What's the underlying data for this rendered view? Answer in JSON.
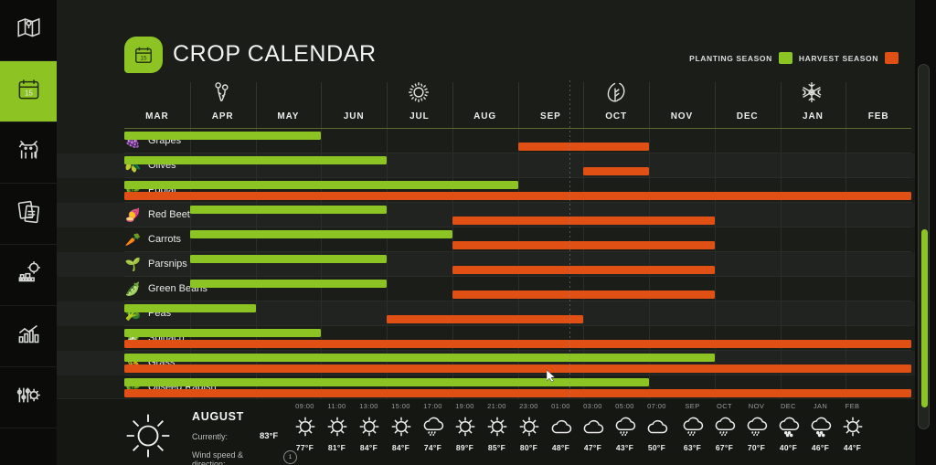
{
  "app": {
    "title": "CROP CALENDAR",
    "logo_icon": "calendar-15-icon",
    "accent_green": "#8cc424",
    "accent_orange": "#e04f13",
    "background": "#1b1d19"
  },
  "sidebar": {
    "items": [
      {
        "name": "map-icon",
        "label": "Map",
        "active": false
      },
      {
        "name": "calendar-icon",
        "label": "Calendar",
        "active": true
      },
      {
        "name": "livestock-cow-icon",
        "label": "Animals",
        "active": false
      },
      {
        "name": "documents-icon",
        "label": "Contracts",
        "active": false
      },
      {
        "name": "production-factory-icon",
        "label": "Production",
        "active": false
      },
      {
        "name": "statistics-bar-chart-icon",
        "label": "Statistics",
        "active": false
      },
      {
        "name": "settings-sliders-gear-icon",
        "label": "Settings",
        "active": false
      }
    ]
  },
  "legend": {
    "planting_label": "PLANTING SEASON",
    "planting_color": "#8cc424",
    "harvest_label": "HARVEST SEASON",
    "harvest_color": "#e04f13"
  },
  "calendar": {
    "months": [
      "MAR",
      "APR",
      "MAY",
      "JUN",
      "JUL",
      "AUG",
      "SEP",
      "OCT",
      "NOV",
      "DEC",
      "JAN",
      "FEB"
    ],
    "season_icons": [
      {
        "name": "spring-flower-icon",
        "month_index": 1
      },
      {
        "name": "summer-sun-icon",
        "month_index": 4
      },
      {
        "name": "autumn-leaf-icon",
        "month_index": 7
      },
      {
        "name": "winter-snowflake-icon",
        "month_index": 10
      }
    ],
    "current_month_marker": "AUG",
    "rows": [
      {
        "crop": "Grapes",
        "icon": "grapes-icon",
        "planting": [
          0,
          3
        ],
        "harvest": [
          6,
          8
        ]
      },
      {
        "crop": "Olives",
        "icon": "olives-icon",
        "planting": [
          0,
          4
        ],
        "harvest": [
          7,
          8
        ]
      },
      {
        "crop": "Poplar",
        "icon": "poplar-leaf-icon",
        "planting": [
          0,
          6
        ],
        "harvest": [
          0,
          12
        ]
      },
      {
        "crop": "Red Beet",
        "icon": "red-beet-icon",
        "planting": [
          1,
          4
        ],
        "harvest": [
          5,
          9
        ]
      },
      {
        "crop": "Carrots",
        "icon": "carrot-icon",
        "planting": [
          1,
          5
        ],
        "harvest": [
          5,
          9
        ]
      },
      {
        "crop": "Parsnips",
        "icon": "parsnip-icon",
        "planting": [
          1,
          4
        ],
        "harvest": [
          5,
          9
        ]
      },
      {
        "crop": "Green Beans",
        "icon": "green-beans-icon",
        "planting": [
          1,
          4
        ],
        "harvest": [
          5,
          9
        ]
      },
      {
        "crop": "Peas",
        "icon": "peas-icon",
        "planting": [
          0,
          2
        ],
        "harvest": [
          4,
          7
        ]
      },
      {
        "crop": "Spinach",
        "icon": "spinach-icon",
        "planting": [
          0,
          3
        ],
        "harvest": [
          0,
          12
        ]
      },
      {
        "crop": "Grass",
        "icon": "grass-icon",
        "planting": [
          0,
          9
        ],
        "harvest": [
          0,
          12
        ]
      },
      {
        "crop": "Oilseed Radish",
        "icon": "oilseed-radish-icon",
        "planting": [
          0,
          8
        ],
        "harvest": [
          0,
          12
        ]
      }
    ]
  },
  "weather": {
    "current_icon": "sun-icon",
    "month": "AUGUST",
    "currently_label": "Currently:",
    "currently_value": "83°F",
    "wind_label": "Wind speed & direction:",
    "wind_dial": "1",
    "hourly": [
      {
        "time": "09:00",
        "icon": "sun-icon",
        "temp": "77°F"
      },
      {
        "time": "11:00",
        "icon": "sun-icon",
        "temp": "81°F"
      },
      {
        "time": "13:00",
        "icon": "sun-icon",
        "temp": "84°F"
      },
      {
        "time": "15:00",
        "icon": "sun-icon",
        "temp": "84°F"
      },
      {
        "time": "17:00",
        "icon": "rain-icon",
        "temp": "74°F"
      },
      {
        "time": "19:00",
        "icon": "sun-icon",
        "temp": "89°F"
      },
      {
        "time": "21:00",
        "icon": "sun-icon",
        "temp": "85°F"
      },
      {
        "time": "23:00",
        "icon": "sun-icon",
        "temp": "80°F"
      },
      {
        "time": "01:00",
        "icon": "cloud-icon",
        "temp": "48°F"
      },
      {
        "time": "03:00",
        "icon": "cloud-icon",
        "temp": "47°F"
      },
      {
        "time": "05:00",
        "icon": "rain-icon",
        "temp": "43°F"
      },
      {
        "time": "07:00",
        "icon": "cloud-icon",
        "temp": "50°F"
      }
    ],
    "monthly": [
      {
        "time": "SEP",
        "icon": "rain-icon",
        "temp": "63°F"
      },
      {
        "time": "OCT",
        "icon": "rain-icon",
        "temp": "67°F"
      },
      {
        "time": "NOV",
        "icon": "rain-icon",
        "temp": "70°F"
      },
      {
        "time": "DEC",
        "icon": "snow-icon",
        "temp": "40°F"
      },
      {
        "time": "JAN",
        "icon": "snow-icon",
        "temp": "46°F"
      },
      {
        "time": "FEB",
        "icon": "sun-icon",
        "temp": "44°F"
      }
    ]
  },
  "scrollbar": {
    "name": "vertical-scrollbar",
    "thumb_color": "#8cc424"
  }
}
